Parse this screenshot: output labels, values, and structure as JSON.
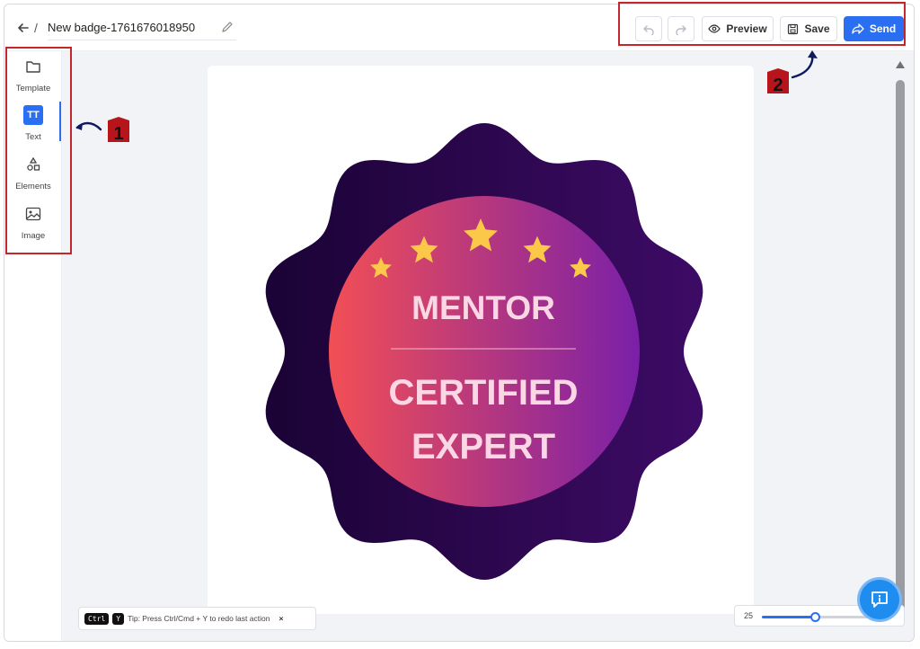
{
  "header": {
    "breadcrumb_separator": "/",
    "badge_name": "New badge-1761676018950",
    "buttons": {
      "preview": "Preview",
      "save": "Save",
      "send": "Send"
    }
  },
  "sidebar": {
    "items": [
      {
        "label": "Template",
        "icon": "folder-icon"
      },
      {
        "label": "Text",
        "icon": "text-icon",
        "glyph": "TT"
      },
      {
        "label": "Elements",
        "icon": "shapes-icon"
      },
      {
        "label": "Image",
        "icon": "image-icon"
      }
    ],
    "active": "Text"
  },
  "canvas": {
    "badge": {
      "line1": "MENTOR",
      "line2": "CERTIFIED",
      "line3": "EXPERT",
      "stars": 5,
      "colors": {
        "outer_dark": "#1a0335",
        "outer_light": "#3d0b66",
        "inner_left": "#f24f55",
        "inner_right": "#7a20a8",
        "text": "#fbd6e4",
        "star": "#fbc84a"
      }
    }
  },
  "tip": {
    "key1": "Ctrl",
    "key2": "Y",
    "text": "Tip: Press Ctrl/Cmd + Y to redo last action",
    "close": "×"
  },
  "zoom": {
    "value": "25",
    "level": 0.42
  },
  "annotations": {
    "marker1": "1",
    "marker2": "2",
    "highlight_color": "#c4262e"
  },
  "accent_color": "#2a6ff2"
}
